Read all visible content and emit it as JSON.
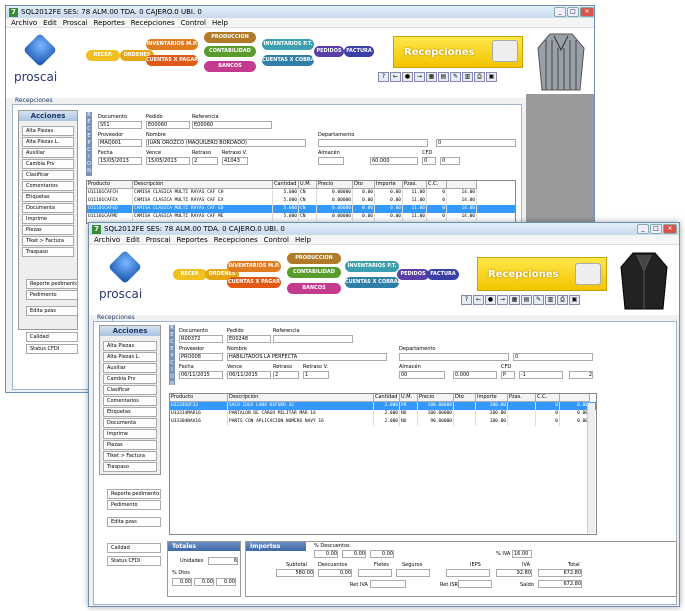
{
  "w1": {
    "title": "SQL2012FE  SES: 78  ALM.00  TDA. 0  CAJERO.0  UBI. 0",
    "menu": [
      "Archivo",
      "Edit",
      "Proscai",
      "Reportes",
      "Recepciones",
      "Control",
      "Help"
    ],
    "section": "Recepciones",
    "labels": {
      "documento": "Documento",
      "pedido": "Pedido",
      "referencia": "Referencia",
      "proveedor": "Proveedor",
      "nombre": "Nombre",
      "departamento": "Departamento",
      "fecha": "Fecha",
      "vence": "Vence",
      "retraso": "Retraso",
      "retraso_v": "Retraso V.",
      "almacen": "Almacén",
      "cfd": "CFD"
    },
    "fields": {
      "documento": "S51",
      "pedido": "E00060",
      "referencia": "E00060",
      "proveedor": "MAQ001",
      "nombre": "JUAN OROZCO (MAQUILERO BORDADO)",
      "dep_code": "0",
      "fecha": "15/05/2013",
      "vence": "15/05/2013",
      "retraso": "2",
      "retraso_v": "41043",
      "almacen": "60.000",
      "cfd1": "0",
      "cfd2": "0"
    },
    "columns": [
      "Producto",
      "Descripción",
      "Cantidad",
      "U.M.",
      "Precio",
      "Dto",
      "Importe",
      "Pzas.",
      "C.C."
    ],
    "rows": [
      [
        "U11101CAFCH",
        "CAMISA CLASICA MULTI RAYAS CAF CH",
        "5.000",
        "CN",
        "0.00000",
        "0.00",
        "0.00",
        "11.00",
        "0",
        "14.00"
      ],
      [
        "U11101CAFEX",
        "CAMISA CLASICA MULTI RAYAS CAF EX",
        "5.000",
        "CN",
        "0.00000",
        "0.00",
        "0.00",
        "11.00",
        "0",
        "14.00"
      ],
      [
        "U11101CAFGD",
        "CAMISA CLASICA MULTI RAYAS CAF GD",
        "5.000",
        "CN",
        "0.00000",
        "0.00",
        "0.00",
        "11.00",
        "0",
        "14.00"
      ],
      [
        "U11101CAFME",
        "CAMISA CLASICA MULTI RAYAS CAF ME",
        "5.000",
        "CN",
        "0.00000",
        "0.00",
        "0.00",
        "11.00",
        "0",
        "14.00"
      ]
    ],
    "actions_title": "Acciones",
    "actions": [
      "Alta Piezas",
      "Alta Piezas L.",
      "Auxiliar",
      "Cambia Prv",
      "Clasificar",
      "Comentarios",
      "Etiquetas",
      "Documenta",
      "Imprime",
      "Piezas",
      "Tiket > Factura",
      "Traspaso"
    ],
    "extra": [
      "Reporte pedimento",
      "Pedimento",
      "Edita pzas"
    ],
    "bottom": [
      "Calidad",
      "Status CFDI"
    ]
  },
  "w2": {
    "title": "SQL2012FE  SES: 78  ALM.00  TDA. 0  CAJERO.0  UBI. 0",
    "menu": [
      "Archivo",
      "Edit",
      "Proscai",
      "Reportes",
      "Recepciones",
      "Control",
      "Help"
    ],
    "section": "Recepciones",
    "labels": {
      "documento": "Documento",
      "pedido": "Pedido",
      "referencia": "Referencia",
      "proveedor": "Proveedor",
      "nombre": "Nombre",
      "departamento": "Departamento",
      "fecha": "Fecha",
      "vence": "Vence",
      "retraso": "Retraso",
      "retraso_v": "Retraso V.",
      "almacen": "Almacén",
      "cfd": "CFD"
    },
    "fields": {
      "documento": "R00372",
      "pedido": "E00248",
      "referencia": "",
      "proveedor": "PRO008",
      "nombre": "HABILITADOS LA PERFECTA",
      "dep_code": "0",
      "fecha": "06/11/2015",
      "vence": "06/11/2015",
      "retraso": "2",
      "retraso_v": "1",
      "almacen": "00",
      "alm_val": "0.000",
      "cfd1": "P",
      "cfd2": "-1",
      "cfd3": "2"
    },
    "columns": [
      "Producto",
      "Descripción",
      "Cantidad",
      "U.M.",
      "Precio",
      "Dto",
      "Importe",
      "Pzas.",
      "C.C."
    ],
    "rows": [
      [
        "U22203OF32",
        "SACO IDEA LANA OXFORD 32",
        "2.000",
        "PR",
        "100.00000",
        "200.00",
        "0",
        "0.00"
      ],
      [
        "U33314MAR16",
        "PANTALON DE CARGO MILITAR MAR 16",
        "2.000",
        "NO",
        "100.00000",
        "200.00",
        "0",
        "0.00"
      ],
      [
        "U33304NAV16",
        "PANTS CON APLICACION NUMERO NAVY 16",
        "2.000",
        "NO",
        "90.00000",
        "180.00",
        "0",
        "0.00"
      ]
    ],
    "actions_title": "Acciones",
    "actions": [
      "Alta Piezas",
      "Alta Piezas L.",
      "Auxiliar",
      "Cambia Prv",
      "Clasificar",
      "Comentarios",
      "Etiquetas",
      "Documenta",
      "Imprime",
      "Piezas",
      "Tiket > Factura",
      "Traspaso"
    ],
    "extra": [
      "Reporte pedimento",
      "Pedimento",
      "Edita pzas"
    ],
    "bottom": [
      "Calidad",
      "Status CFDI"
    ],
    "totales": {
      "title": "Totales",
      "unidades_label": "Unidades",
      "unidades": "6",
      "dtos_label": "% Dtos",
      "d1": "0.00",
      "d2": "0.00",
      "d3": "0.00"
    },
    "importes": {
      "title": "Importes",
      "pct_desc_label": "% Descuentos",
      "p1": "0.00",
      "p2": "0.00",
      "p3": "0.00",
      "iva_pct_label": "% IVA",
      "iva_pct": "16.00",
      "subtotal_label": "Subtotal",
      "subtotal": "580.00",
      "descuentos_label": "Descuentos",
      "descuentos": "0.00",
      "fletes_label": "Fletes",
      "seguros_label": "Seguros",
      "ieps_label": "IEPS",
      "iva_label": "IVA",
      "iva": "92.80",
      "total_label": "Total",
      "total": "672.80",
      "ret_iva_label": "Ret IVA",
      "ret_isr_label": "Ret ISR",
      "saldo_label": "Saldo",
      "saldo": "672.80"
    }
  },
  "banner": {
    "logo": "proscai",
    "recepciones": "Recepciones",
    "modules": [
      "RECEP.",
      "ORDENES",
      "INVENTARIOS M.P.",
      "PRODUCCION",
      "CUENTAS X PAGAR",
      "CONTABILIDAD",
      "BANCOS",
      "INVENTARIOS P.T.",
      "CUENTAS X COBRAR",
      "PEDIDOS",
      "FACTURA"
    ],
    "tools": [
      "?",
      "←",
      "●",
      "→",
      "▦",
      "▤",
      "✎",
      "▥",
      "⎙",
      "▣"
    ]
  }
}
